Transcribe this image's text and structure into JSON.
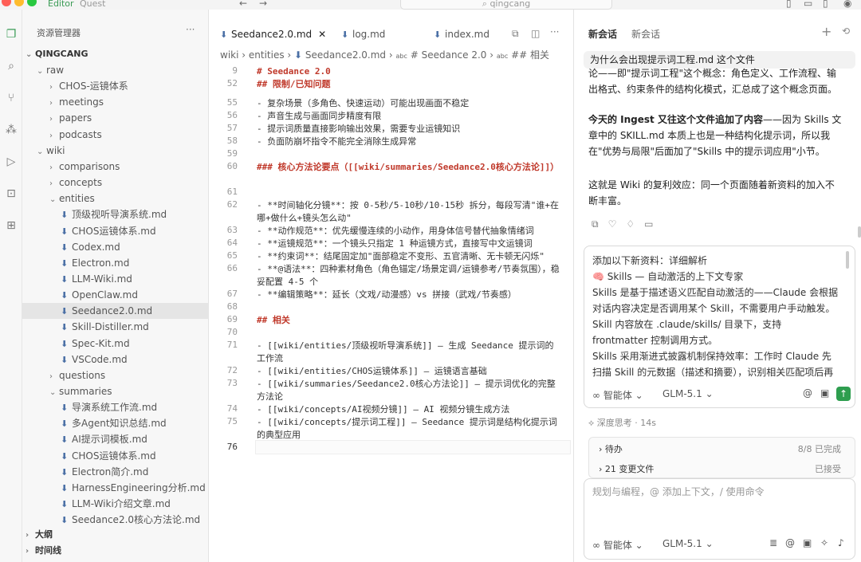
{
  "titlebar": {
    "mode_editor": "Editor",
    "mode_quest": "Quest",
    "search": "qingcang"
  },
  "explorer": {
    "title": "资源管理器",
    "more": "···",
    "root": "QINGCANG",
    "items": [
      {
        "label": "raw",
        "type": "folder-open"
      },
      {
        "label": "CHOS-运镜体系",
        "type": "folder"
      },
      {
        "label": "meetings",
        "type": "folder"
      },
      {
        "label": "papers",
        "type": "folder"
      },
      {
        "label": "podcasts",
        "type": "folder"
      },
      {
        "label": "wiki",
        "type": "folder-open"
      },
      {
        "label": "comparisons",
        "type": "folder"
      },
      {
        "label": "concepts",
        "type": "folder"
      },
      {
        "label": "entities",
        "type": "folder-open"
      },
      {
        "label": "顶级视听导演系统.md",
        "type": "file"
      },
      {
        "label": "CHOS运镜体系.md",
        "type": "file"
      },
      {
        "label": "Codex.md",
        "type": "file"
      },
      {
        "label": "Electron.md",
        "type": "file"
      },
      {
        "label": "LLM-Wiki.md",
        "type": "file"
      },
      {
        "label": "OpenClaw.md",
        "type": "file"
      },
      {
        "label": "Seedance2.0.md",
        "type": "file"
      },
      {
        "label": "Skill-Distiller.md",
        "type": "file"
      },
      {
        "label": "Spec-Kit.md",
        "type": "file"
      },
      {
        "label": "VSCode.md",
        "type": "file"
      },
      {
        "label": "questions",
        "type": "folder"
      },
      {
        "label": "summaries",
        "type": "folder-open"
      },
      {
        "label": "导演系统工作流.md",
        "type": "file"
      },
      {
        "label": "多Agent知识总结.md",
        "type": "file"
      },
      {
        "label": "AI提示词模板.md",
        "type": "file"
      },
      {
        "label": "CHOS运镜体系.md",
        "type": "file"
      },
      {
        "label": "Electron简介.md",
        "type": "file"
      },
      {
        "label": "HarnessEngineering分析.md",
        "type": "file"
      },
      {
        "label": "LLM-Wiki介绍文章.md",
        "type": "file"
      },
      {
        "label": "Seedance2.0核心方法论.md",
        "type": "file"
      }
    ],
    "outline": "大纲",
    "timeline": "时间线"
  },
  "editor": {
    "tabs": [
      "Seedance2.0.md",
      "log.md",
      "index.md"
    ],
    "breadcrumb": {
      "p1": "wiki",
      "p2": "entities",
      "p3": "Seedance2.0.md",
      "p4": "# Seedance 2.0",
      "p5": "## 相关"
    },
    "lines": [
      {
        "n": "9",
        "t": "# Seedance 2.0"
      },
      {
        "n": "52",
        "t": "## 限制/已知问题"
      },
      {
        "n": "55",
        "t": "- 复杂场景（多角色、快速运动）可能出现画面不稳定"
      },
      {
        "n": "56",
        "t": "- 声音生成与画面同步精度有限"
      },
      {
        "n": "57",
        "t": "- 提示词质量直接影响输出效果，需要专业运镜知识"
      },
      {
        "n": "58",
        "t": "- 负面防崩坏指令不能完全消除生成异常"
      },
      {
        "n": "59",
        "t": ""
      },
      {
        "n": "60",
        "t": "### 核心方法论要点（[[wiki/summaries/Seedance2.0核心方法论]]）"
      },
      {
        "n": "61",
        "t": ""
      },
      {
        "n": "62",
        "t": "- **时间轴化分镜**：按 0-5秒/5-10秒/10-15秒 拆分，每段写清\"谁+在哪+做什么+镜头怎么动\""
      },
      {
        "n": "63",
        "t": "- **动作规范**：优先缓慢连续的小动作，用身体信号替代抽象情绪词"
      },
      {
        "n": "64",
        "t": "- **运镜规范**：一个镜头只指定 1 种运镜方式，直接写中文运镜词"
      },
      {
        "n": "65",
        "t": "- **约束词**：结尾固定加\"面部稳定不变形、五官清晰、无卡顿无闪烁\""
      },
      {
        "n": "66",
        "t": "- **@语法**：四种素材角色（角色锚定/场景定调/运镜参考/节奏氛围），稳妥配置 4-5 个"
      },
      {
        "n": "67",
        "t": "- **编辑策略**：延长（文戏/动漫感）vs 拼接（武戏/节奏感）"
      },
      {
        "n": "68",
        "t": ""
      },
      {
        "n": "69",
        "t": "## 相关"
      },
      {
        "n": "70",
        "t": ""
      },
      {
        "n": "71",
        "t": "- [[wiki/entities/顶级视听导演系统]] — 生成 Seedance 提示词的工作流"
      },
      {
        "n": "72",
        "t": "- [[wiki/entities/CHOS运镜体系]] — 运镜语言基础"
      },
      {
        "n": "73",
        "t": "- [[wiki/summaries/Seedance2.0核心方法论]] — 提示词优化的完整方法论"
      },
      {
        "n": "74",
        "t": "- [[wiki/concepts/AI视频分镜]] — AI 视频分镜生成方法"
      },
      {
        "n": "75",
        "t": "- [[wiki/concepts/提示词工程]] — Seedance 提示词是结构化提示词的典型应用"
      },
      {
        "n": "76",
        "t": ""
      }
    ]
  },
  "chat": {
    "tab1": "新会话",
    "tab2": "新会话",
    "question": "为什么会出现提示词工程.md 这个文件",
    "para1": "论——即\"提示词工程\"这个概念：角色定义、工作流程、输出格式、约束条件的结构化模式，汇总成了这个概念页面。",
    "para2_bold": "今天的 Ingest 又往这个文件追加了内容",
    "para2_rest": "——因为 Skills 文章中的 SKILL.md 本质上也是一种结构化提示词，所以我在\"优势与局限\"后面加了\"Skills 中的提示词应用\"小节。",
    "para3": "这就是 Wiki 的复利效应：同一个页面随着新资料的加入不断丰富。",
    "compose1_l1": "添加以下新资料：详细解析",
    "compose1_l2": "🧠 Skills — 自动激活的上下文专家",
    "compose1_l3": "Skills 是基于描述语义匹配自动激活的——Claude 会根据对话内容决定是否调用某个 Skill，不需要用户手动触发。Skill 内容放在 .claude/skills/ 目录下，支持 frontmatter 控制调用方式。",
    "compose1_l4": "Skills 采用渐进式披露机制保持效率：工作时 Claude 先扫描 Skill 的元数据（描述和摘要），识别相关匹配项后再加载完",
    "mode": "智能体",
    "model": "GLM-5.1",
    "thinking": "深度思考 · 14s",
    "todo_label": "待办",
    "todo_status": "8/8 已完成",
    "changes_label": "21 变更文件",
    "changes_status": "已接受",
    "placeholder": "规划与编程，@ 添加上下文，/ 使用命令"
  }
}
